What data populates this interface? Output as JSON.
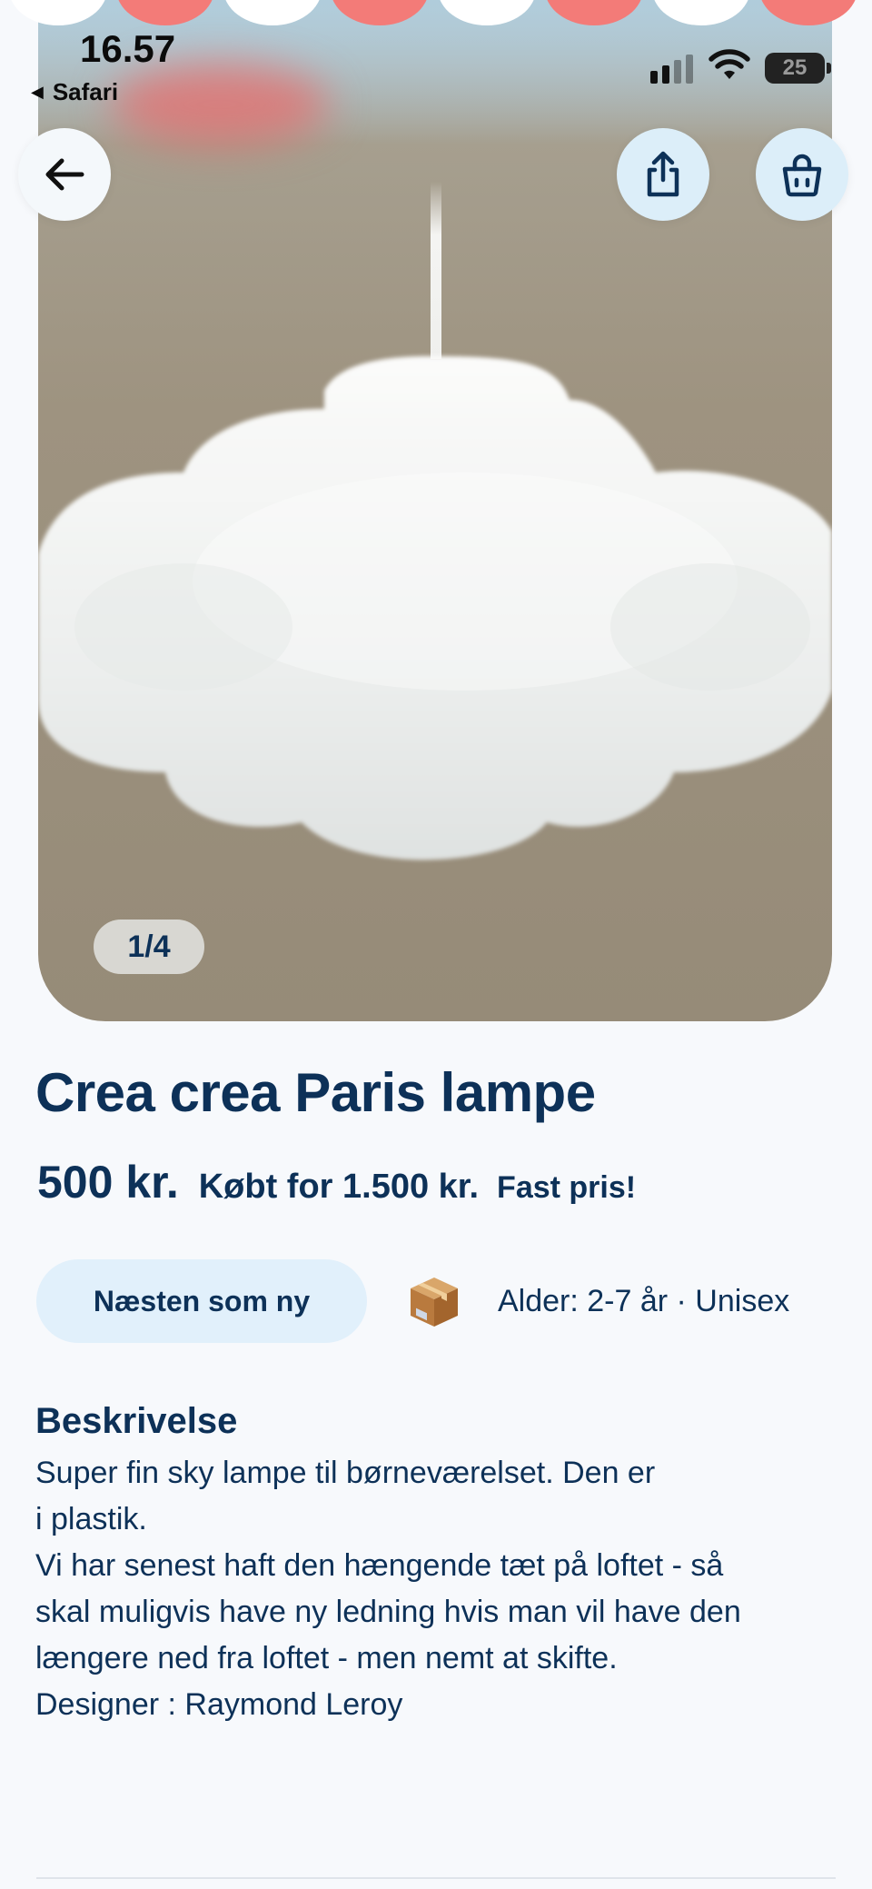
{
  "status_bar": {
    "time": "16.57",
    "back_app": "Safari",
    "battery_level": "25"
  },
  "product": {
    "image_counter": "1/4",
    "title": "Crea crea Paris lampe",
    "price": "500 kr.",
    "bought_for": "Købt for 1.500 kr.",
    "price_note": "Fast pris!",
    "condition": "Næsten som ny",
    "age_gender": "Alder: 2-7 år · Unisex"
  },
  "description": {
    "heading": "Beskrivelse",
    "lines": [
      "Super fin sky lampe til børneværelset. Den er",
      "i plastik.",
      "Vi har senest haft den hængende tæt på loftet - så",
      "skal muligvis have ny ledning hvis man vil have den",
      "længere ned fra loftet - men nemt at skifte.",
      "Designer : Raymond Leroy"
    ]
  },
  "icons": {
    "back": "arrow-left-icon",
    "share": "share-icon",
    "cart": "shopping-bag-icon",
    "shipping": "package-box-icon"
  },
  "colors": {
    "primary_text": "#0d3158",
    "chip_background": "#e1f0fb",
    "icon_button_background": "#dceef9",
    "page_background": "#f7f9fc",
    "accent_coral": "#f37b78"
  }
}
